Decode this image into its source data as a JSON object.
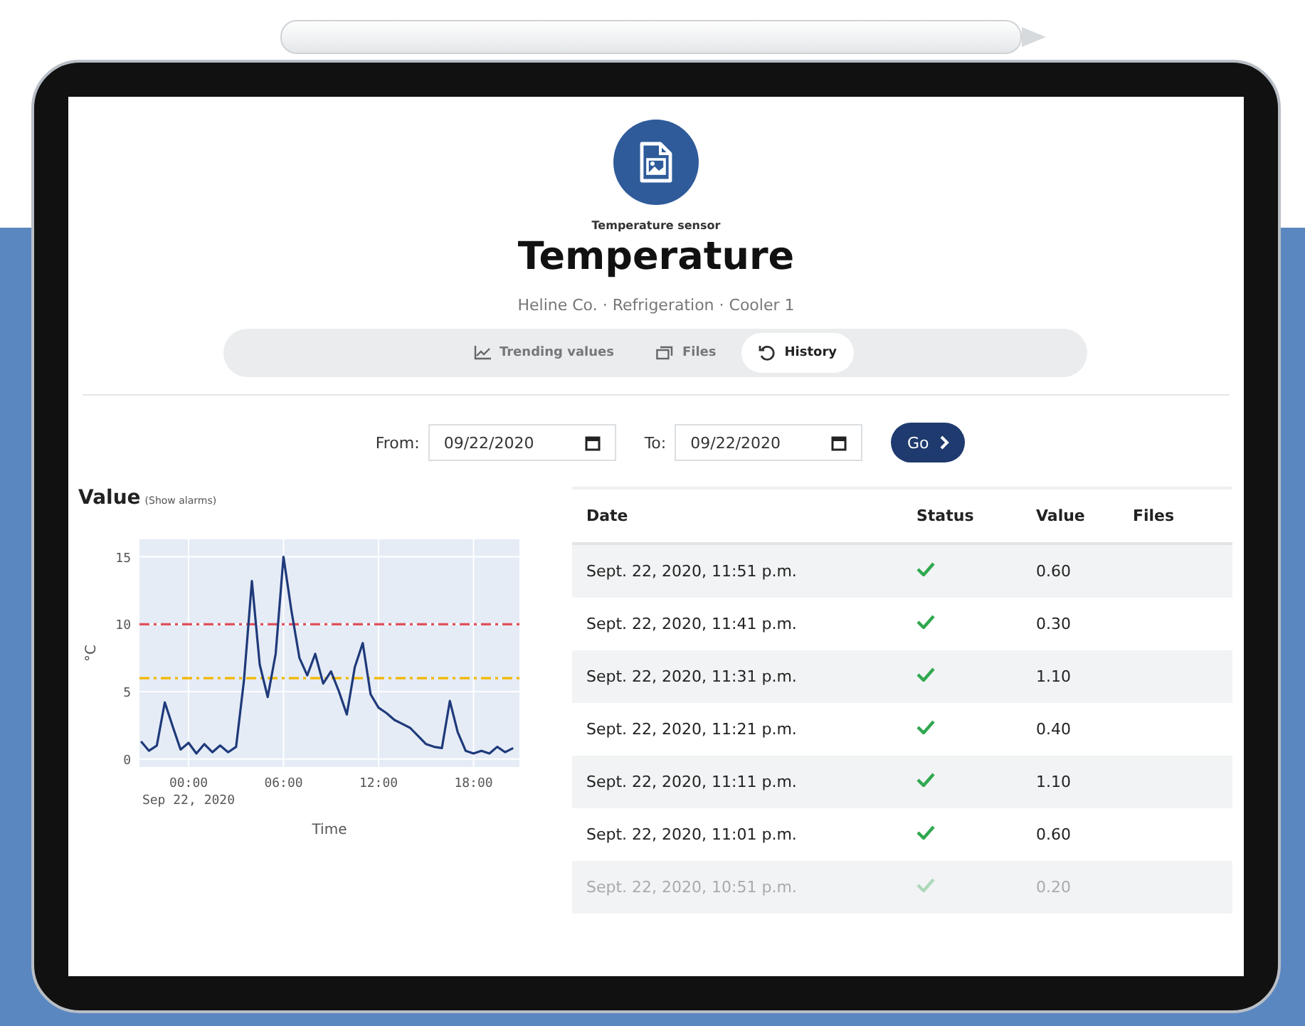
{
  "header": {
    "category": "Temperature sensor",
    "title": "Temperature",
    "breadcrumb": "Heline Co. · Refrigeration · Cooler 1"
  },
  "tabs": [
    {
      "label": "Trending values",
      "kind": "chart",
      "selected": false
    },
    {
      "label": "Files",
      "kind": "files",
      "selected": false
    },
    {
      "label": "History",
      "kind": "history",
      "selected": true
    }
  ],
  "filter": {
    "from_label": "From:",
    "from_value": "09/22/2020",
    "to_label": "To:",
    "to_value": "09/22/2020",
    "go_button": "Go"
  },
  "chart_panel": {
    "title": "Value",
    "link": "(Show alarms)",
    "date_note": "Sep 22, 2020",
    "chart_data": {
      "type": "line",
      "grid": true,
      "xlabel": "Time",
      "ylabel": "°C",
      "xlim": [
        -3.1,
        20.9
      ],
      "ylim": [
        -0.6,
        16.3
      ],
      "yticks": [
        0,
        5,
        10,
        15
      ],
      "xticks": [
        {
          "value": 0,
          "label": "00:00"
        },
        {
          "value": 6,
          "label": "06:00"
        },
        {
          "value": 12,
          "label": "12:00"
        },
        {
          "value": 18,
          "label": "18:00"
        }
      ],
      "x": [
        -3,
        -2.5,
        -2,
        -1.5,
        -1,
        -0.5,
        0,
        0.5,
        1,
        1.5,
        2,
        2.5,
        3,
        3.5,
        4,
        4.5,
        5,
        5.5,
        6,
        6.5,
        7,
        7.5,
        8,
        8.5,
        9,
        9.5,
        10,
        10.5,
        11,
        11.5,
        12,
        12.5,
        13,
        13.5,
        14,
        14.5,
        15,
        15.5,
        16,
        16.5,
        17,
        17.5,
        18,
        18.5,
        19,
        19.5,
        20,
        20.5
      ],
      "series": [
        {
          "color": "#1f3a7a",
          "values": [
            1.3,
            0.6,
            1.0,
            4.2,
            2.4,
            0.7,
            1.2,
            0.4,
            1.1,
            0.5,
            1.0,
            0.5,
            0.9,
            5.8,
            13.2,
            7.0,
            4.6,
            7.8,
            15.0,
            11.0,
            7.5,
            6.2,
            7.8,
            5.6,
            6.5,
            5.0,
            3.3,
            6.8,
            8.6,
            4.8,
            3.8,
            3.4,
            2.9,
            2.6,
            2.3,
            1.7,
            1.1,
            0.9,
            0.8,
            4.3,
            2.0,
            0.6,
            0.4,
            0.6,
            0.4,
            0.9,
            0.5,
            0.8
          ]
        }
      ],
      "ref_lines": [
        {
          "axis": "y",
          "value": 10,
          "color": "#e0505a"
        },
        {
          "axis": "y",
          "value": 6,
          "color": "#f2b600"
        }
      ]
    }
  },
  "table": {
    "columns": [
      "Date",
      "Status",
      "Value",
      "Files"
    ],
    "rows": [
      {
        "date": "Sept. 22, 2020, 11:51 p.m.",
        "ok": true,
        "value": "0.60",
        "faded": false
      },
      {
        "date": "Sept. 22, 2020, 11:41 p.m.",
        "ok": true,
        "value": "0.30",
        "faded": false
      },
      {
        "date": "Sept. 22, 2020, 11:31 p.m.",
        "ok": true,
        "value": "1.10",
        "faded": false
      },
      {
        "date": "Sept. 22, 2020, 11:21 p.m.",
        "ok": true,
        "value": "0.40",
        "faded": false
      },
      {
        "date": "Sept. 22, 2020, 11:11 p.m.",
        "ok": true,
        "value": "1.10",
        "faded": false
      },
      {
        "date": "Sept. 22, 2020, 11:01 p.m.",
        "ok": true,
        "value": "0.60",
        "faded": false
      },
      {
        "date": "Sept. 22, 2020, 10:51 p.m.",
        "ok": true,
        "value": "0.20",
        "faded": true
      }
    ]
  }
}
